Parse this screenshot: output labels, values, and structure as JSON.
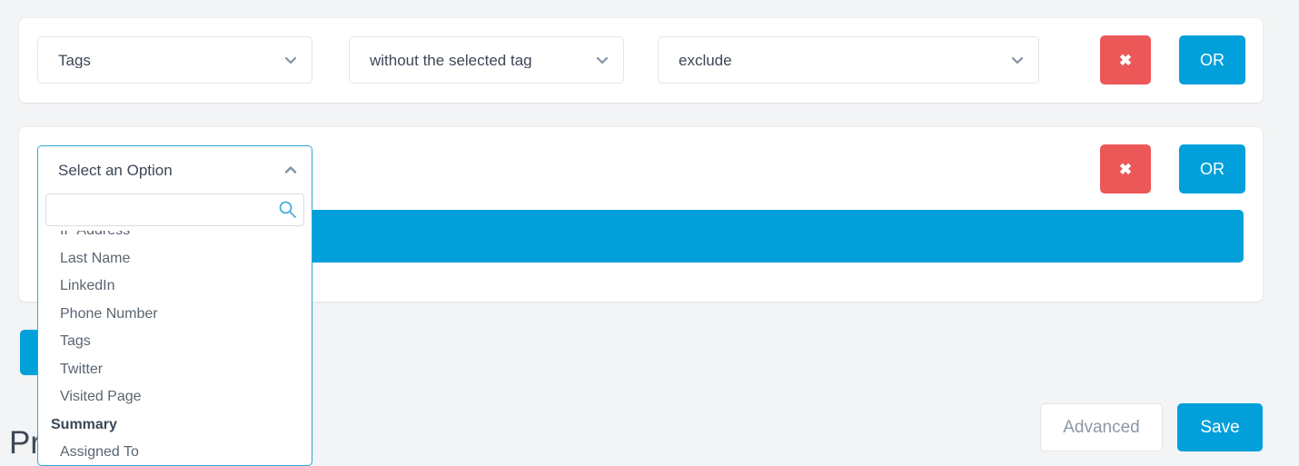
{
  "colors": {
    "accent_blue": "#01a0db",
    "danger_red": "#ec5758",
    "page_bg": "#f3f4f5",
    "card_bg": "#ffffff",
    "border_gray": "#e2e5e8",
    "text_dark": "#3c4856",
    "text_muted": "#8d99a6",
    "dropdown_border": "#2ea6d8"
  },
  "filter_rows": [
    {
      "field_select": "Tags",
      "operator_select": "without the selected tag",
      "value_select": "exclude",
      "remove_label": "✖",
      "or_label": "OR"
    },
    {
      "field_select": "Select an Option",
      "remove_label": "✖",
      "or_label": "OR",
      "add_bar_label": ""
    }
  ],
  "dropdown": {
    "title": "Select an Option",
    "toggle_icon": "chevron-up-icon",
    "search": {
      "value": "",
      "placeholder": "",
      "icon": "search-icon"
    },
    "entries": [
      {
        "type": "item",
        "label": "IP Address"
      },
      {
        "type": "item",
        "label": "Last Name"
      },
      {
        "type": "item",
        "label": "LinkedIn"
      },
      {
        "type": "item",
        "label": "Phone Number"
      },
      {
        "type": "item",
        "label": "Tags"
      },
      {
        "type": "item",
        "label": "Twitter"
      },
      {
        "type": "item",
        "label": "Visited Page"
      },
      {
        "type": "group",
        "label": "Summary"
      },
      {
        "type": "item",
        "label": "Assigned To"
      }
    ]
  },
  "and_button": {
    "label": ""
  },
  "page_heading": "Pr",
  "footer": {
    "advanced_label": "Advanced",
    "save_label": "Save"
  }
}
